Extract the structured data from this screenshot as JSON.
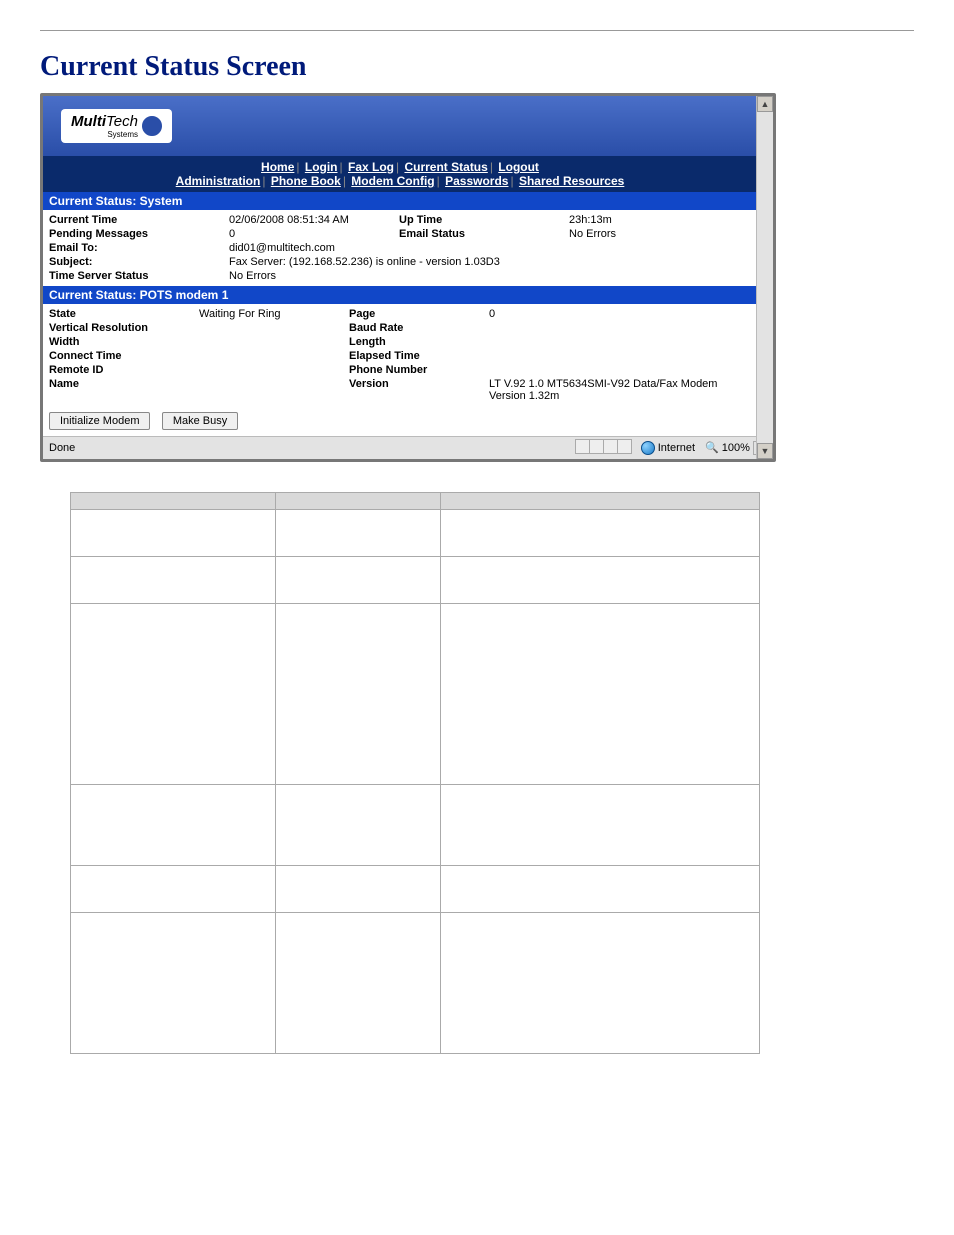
{
  "page_title": "Current Status Screen",
  "logo": {
    "bold": "Multi",
    "thin": "Tech",
    "sub": "Systems"
  },
  "nav": {
    "row1": [
      "Home",
      "Login",
      "Fax Log",
      "Current Status",
      "Logout"
    ],
    "row2": [
      "Administration",
      "Phone Book",
      "Modem Config",
      "Passwords",
      "Shared Resources"
    ]
  },
  "sections": {
    "system": {
      "title": "Current Status: System",
      "rows": {
        "current_time_label": "Current Time",
        "current_time_value": "02/06/2008 08:51:34 AM",
        "up_time_label": "Up Time",
        "up_time_value": "23h:13m",
        "pending_messages_label": "Pending Messages",
        "pending_messages_value": "0",
        "email_status_label": "Email Status",
        "email_status_value": "No Errors",
        "email_to_label": "Email To:",
        "email_to_value": "did01@multitech.com",
        "subject_label": "Subject:",
        "subject_value": "Fax Server: (192.168.52.236) is online - version 1.03D3",
        "time_server_status_label": "Time Server Status",
        "time_server_status_value": "No Errors"
      }
    },
    "modem": {
      "title": "Current Status: POTS modem 1",
      "rows": {
        "state_label": "State",
        "state_value": "Waiting For Ring",
        "page_label": "Page",
        "page_value": "0",
        "vertical_resolution_label": "Vertical Resolution",
        "baud_rate_label": "Baud Rate",
        "width_label": "Width",
        "length_label": "Length",
        "connect_time_label": "Connect Time",
        "elapsed_time_label": "Elapsed Time",
        "remote_id_label": "Remote ID",
        "phone_number_label": "Phone Number",
        "name_label": "Name",
        "version_label": "Version",
        "version_value": "LT V.92 1.0 MT5634SMI-V92 Data/Fax Modem Version 1.32m"
      },
      "buttons": {
        "initialize": "Initialize Modem",
        "make_busy": "Make Busy"
      }
    }
  },
  "status_bar": {
    "done": "Done",
    "zone": "Internet",
    "zoom": "100%"
  }
}
